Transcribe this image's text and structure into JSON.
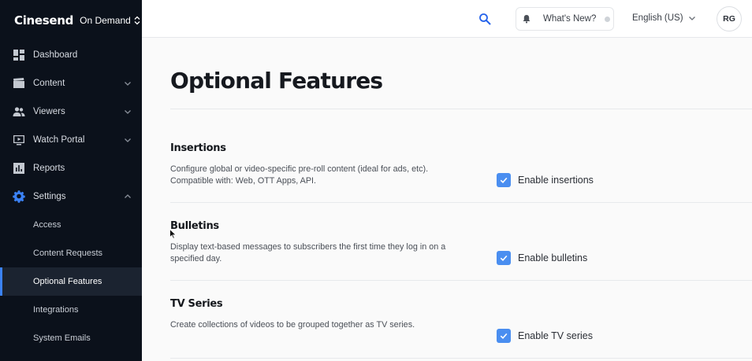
{
  "brand": {
    "logo": "Cinesend",
    "product": "On Demand"
  },
  "sidebar": {
    "items": [
      {
        "label": "Dashboard",
        "icon": "dashboard-icon"
      },
      {
        "label": "Content",
        "icon": "clapperboard-icon",
        "expandable": true
      },
      {
        "label": "Viewers",
        "icon": "people-icon",
        "expandable": true
      },
      {
        "label": "Watch Portal",
        "icon": "monitor-play-icon",
        "expandable": true
      },
      {
        "label": "Reports",
        "icon": "bar-chart-icon"
      },
      {
        "label": "Settings",
        "icon": "gear-icon",
        "expanded": true
      }
    ],
    "settings_sub": [
      {
        "label": "Access"
      },
      {
        "label": "Content Requests"
      },
      {
        "label": "Optional Features",
        "active": true
      },
      {
        "label": "Integrations"
      },
      {
        "label": "System Emails"
      }
    ]
  },
  "topbar": {
    "search_icon": "search-icon",
    "whats_new": "What's New?",
    "language": "English (US)",
    "avatar_initials": "RG"
  },
  "main": {
    "title": "Optional Features",
    "sections": [
      {
        "heading": "Insertions",
        "description": "Configure global or video-specific pre-roll content (ideal for ads, etc). Compatible with: Web, OTT Apps, API.",
        "toggle_label": "Enable insertions",
        "checked": true
      },
      {
        "heading": "Bulletins",
        "description": "Display text-based messages to subscribers the first time they log in on a specified day.",
        "toggle_label": "Enable bulletins",
        "checked": true
      },
      {
        "heading": "TV Series",
        "description": "Create collections of videos to be grouped together as TV series.",
        "toggle_label": "Enable TV series",
        "checked": true
      }
    ]
  },
  "colors": {
    "accent": "#4a8ef0",
    "sidebar_bg": "#0b111b",
    "active_bar": "#3b82f6"
  }
}
